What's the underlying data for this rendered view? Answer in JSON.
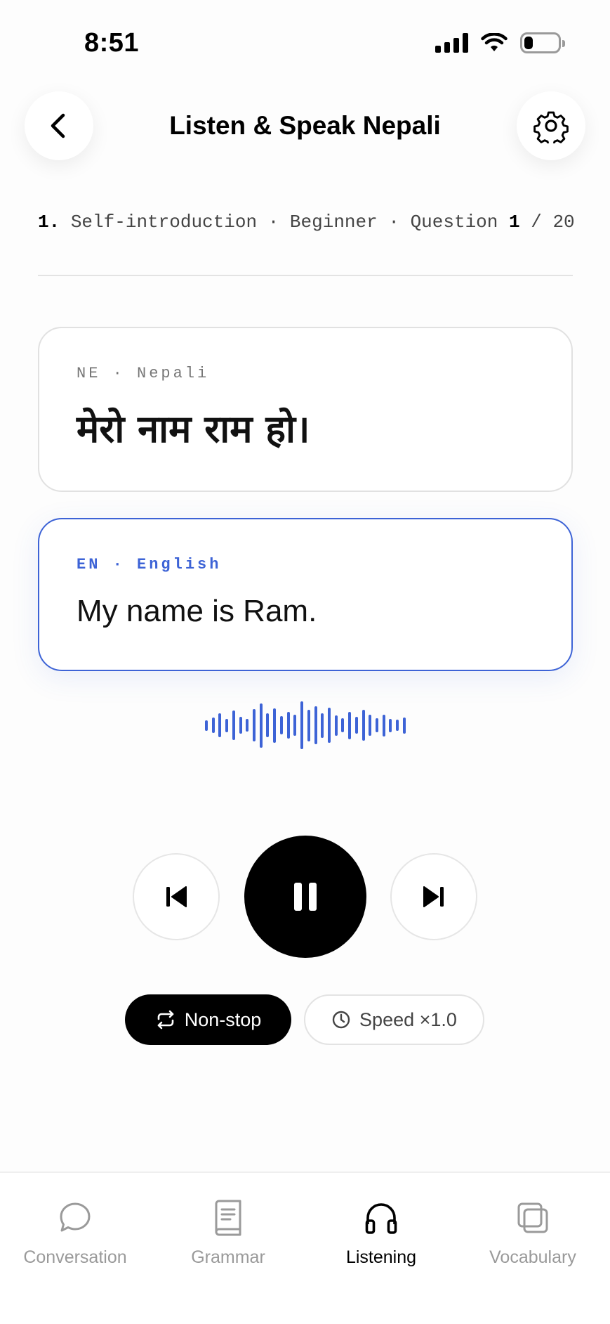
{
  "status_bar": {
    "time": "8:51",
    "battery_level": 0.25
  },
  "header": {
    "title": "Listen & Speak Nepali",
    "back_icon": "chevron-left-icon",
    "settings_icon": "gear-icon"
  },
  "breadcrumb": {
    "number": "1.",
    "topic": "Self-introduction",
    "level": "Beginner",
    "question_label": "Question",
    "current": "1",
    "total": "20",
    "separator": "·"
  },
  "cards": {
    "source": {
      "code": "NE",
      "language": "Nepali",
      "text": "मेरो नाम राम हो।"
    },
    "target": {
      "code": "EN",
      "language": "English",
      "text": "My name is Ram."
    }
  },
  "waveform": {
    "levels": [
      0.22,
      0.32,
      0.5,
      0.28,
      0.62,
      0.36,
      0.26,
      0.68,
      0.92,
      0.5,
      0.72,
      0.38,
      0.56,
      0.44,
      1.0,
      0.66,
      0.8,
      0.52,
      0.74,
      0.42,
      0.3,
      0.58,
      0.36,
      0.64,
      0.44,
      0.3,
      0.46,
      0.28,
      0.24,
      0.34
    ]
  },
  "player": {
    "state": "playing",
    "prev_icon": "skip-previous-icon",
    "pause_icon": "pause-icon",
    "next_icon": "skip-next-icon"
  },
  "controls": {
    "nonstop_label": "Non-stop",
    "nonstop_icon": "repeat-icon",
    "speed_label": "Speed ×1.0",
    "speed_icon": "clock-icon"
  },
  "tabs": [
    {
      "label": "Conversation",
      "icon": "chat-bubble-icon",
      "active": false
    },
    {
      "label": "Grammar",
      "icon": "book-icon",
      "active": false
    },
    {
      "label": "Listening",
      "icon": "headphones-icon",
      "active": true
    },
    {
      "label": "Vocabulary",
      "icon": "cards-icon",
      "active": false
    }
  ],
  "colors": {
    "accent": "#3d63d6",
    "inactive": "#9a9a9a",
    "primary": "#000000"
  }
}
